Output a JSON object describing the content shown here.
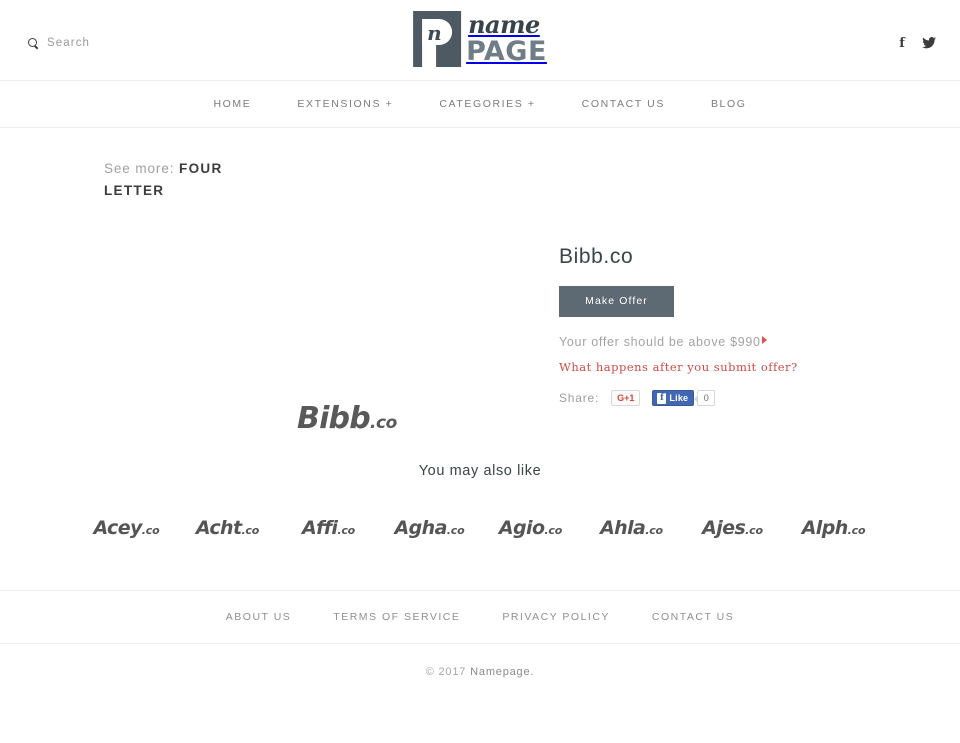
{
  "header": {
    "search": {
      "label": "Search",
      "icon": "search-icon"
    },
    "logo": {
      "mark_letter": "n",
      "name": "name",
      "page": "PAGE"
    },
    "social": [
      {
        "name": "facebook-icon",
        "glyph": "f"
      },
      {
        "name": "twitter-icon",
        "glyph": "🐦"
      }
    ]
  },
  "nav": {
    "items": [
      {
        "label": "HOME"
      },
      {
        "label": "EXTENSIONS +"
      },
      {
        "label": "CATEGORIES +"
      },
      {
        "label": "CONTACT US"
      },
      {
        "label": "BLOG"
      }
    ]
  },
  "seemore": {
    "label": "See more:",
    "link": "FOUR LETTER"
  },
  "product": {
    "logo_name": "Bibb",
    "logo_tld": ".co",
    "title": "Bibb.co",
    "make_offer_label": "Make Offer",
    "offer_note": "Your offer should be above $990",
    "offer_minimum": "$990",
    "offer_link": "What happens after you submit offer?",
    "share_label": "Share:",
    "gplus_label": "G+1",
    "fb_like_label": "Like",
    "fb_count": "0"
  },
  "alsolike": {
    "title": "You may also like",
    "items": [
      {
        "name": "Acey",
        "tld": ".co"
      },
      {
        "name": "Acht",
        "tld": ".co"
      },
      {
        "name": "Affi",
        "tld": ".co"
      },
      {
        "name": "Agha",
        "tld": ".co"
      },
      {
        "name": "Agio",
        "tld": ".co"
      },
      {
        "name": "Ahla",
        "tld": ".co"
      },
      {
        "name": "Ajes",
        "tld": ".co"
      },
      {
        "name": "Alph",
        "tld": ".co"
      }
    ]
  },
  "footer": {
    "links": [
      {
        "label": "ABOUT US"
      },
      {
        "label": "TERMS OF SERVICE"
      },
      {
        "label": "PRIVACY POLICY"
      },
      {
        "label": "CONTACT US"
      }
    ],
    "copyright": "© 2017",
    "brand": "Namepage."
  },
  "colors": {
    "button": "#5d6a73",
    "accent_red": "#cf4a45",
    "facebook_blue": "#4267b2",
    "gplus_red": "#d34836",
    "logo_dark": "#4e5a63"
  }
}
